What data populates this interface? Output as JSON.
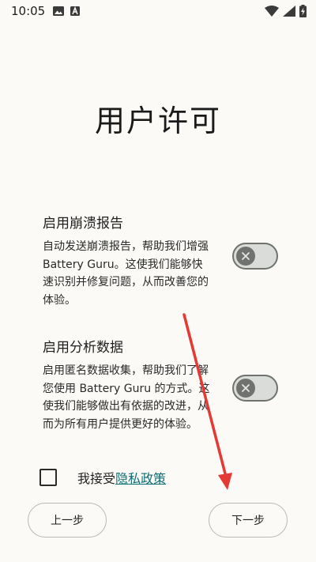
{
  "status_bar": {
    "time": "10:05",
    "left_icons": [
      "image-icon",
      "font-a-icon"
    ],
    "right_icons": [
      "wifi-icon",
      "signal-icon",
      "battery-charging-icon"
    ]
  },
  "page": {
    "title": "用户许可"
  },
  "settings": [
    {
      "title": "启用崩溃报告",
      "description": "自动发送崩溃报告，帮助我们增强 Battery Guru。这使我们能够快速识别并修复问题，从而改善您的体验。",
      "enabled": false
    },
    {
      "title": "启用分析数据",
      "description": "启用匿名数据收集，帮助我们了解您使用 Battery Guru 的方式。这使我们能够做出有依据的改进，从而为所有用户提供更好的体验。",
      "enabled": false
    }
  ],
  "consent": {
    "checked": false,
    "prefix": "我接受",
    "link_label": "隐私政策"
  },
  "buttons": {
    "back_label": "上一步",
    "next_label": "下一步"
  },
  "colors": {
    "background": "#fbfaf7",
    "link": "#0e6f73",
    "toggle_off": "#6f726f",
    "annotation_arrow": "#e53935"
  }
}
